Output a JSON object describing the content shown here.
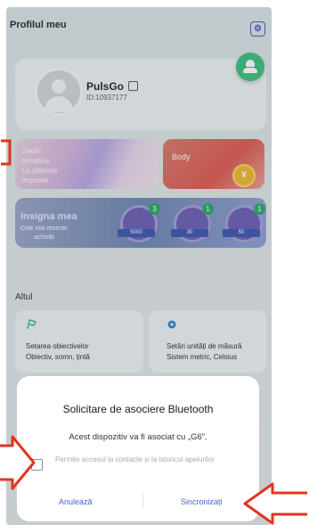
{
  "header": {
    "title": "Profilul meu",
    "settings_icon": "profile-settings-icon"
  },
  "profile": {
    "name": "PulsGo",
    "id": "ID:10937177"
  },
  "cards": {
    "theme_lines": [
      "Setări",
      "tematice",
      "La ultimore",
      "imposite"
    ],
    "body_label": "Body",
    "coin_symbol": "¥"
  },
  "badges": {
    "title": "Insigna mea",
    "subtitle_lines": [
      "Cele mai recente",
      "achiziții"
    ],
    "items": [
      {
        "count": "3",
        "ribbon": "5000",
        "icon": "medal-icon"
      },
      {
        "count": "1",
        "ribbon": "30",
        "icon": "clock-medal-icon"
      },
      {
        "count": "1",
        "ribbon": "50",
        "icon": "clock-medal-icon"
      }
    ]
  },
  "other": {
    "section_title": "Altul",
    "goals": {
      "line1": "Setarea obiectivelor",
      "line2": "Obiectiv, somn, țintă"
    },
    "units": {
      "line1": "Setări unități de măsură",
      "line2": "Sistem metric, Celsius"
    }
  },
  "dialog": {
    "title": "Solicitare de asociere Bluetooth",
    "message": "Acest dispozitiv va fi asociat cu „G6”.",
    "checkbox_label": "Permite accesul la contacte și la istoricul apelurilor",
    "cancel_label": "Anulează",
    "confirm_label": "Sincronizați"
  },
  "colors": {
    "accent_green": "#3cbf7c",
    "annotation_red": "#e0351f",
    "link_blue": "#4a63c0"
  }
}
